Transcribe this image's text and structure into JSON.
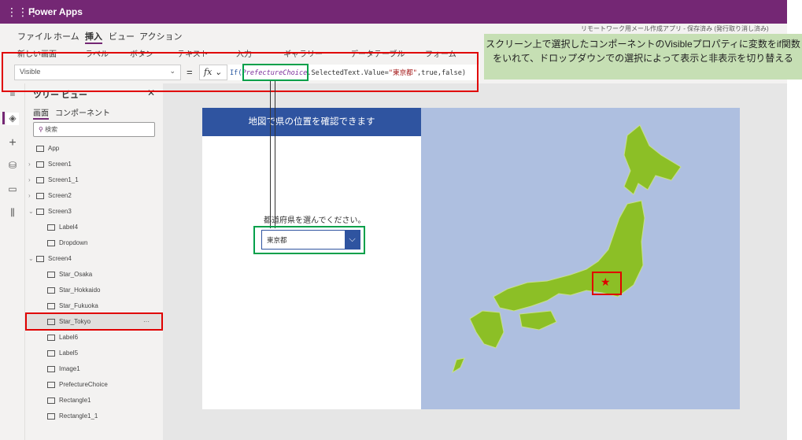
{
  "titlebar": {
    "app_name": "Power Apps",
    "waffle_icon": "waffle-icon"
  },
  "status": "リモートワーク用メール作成アプリ - 保存済み (発行取り消し済み)",
  "menu": [
    "ファイル",
    "ホーム",
    "挿入",
    "ビュー",
    "アクション"
  ],
  "menu_active": "挿入",
  "toolbar": [
    "新しい画面",
    "ラベル",
    "ボタン",
    "テキスト",
    "入力",
    "ギャラリー",
    "データテーブル",
    "フォーム"
  ],
  "formula_bar": {
    "property": "Visible",
    "equals": "=",
    "fx": "fx",
    "f_if": "If(",
    "f_ctl": "PrefectureChoice",
    "f_mid": ".SelectedText.Value=",
    "f_str": "\"東京都\"",
    "f_end": ",true,false)"
  },
  "tree": {
    "title": "ツリー ビュー",
    "tabs": [
      "画面",
      "コンポーネント"
    ],
    "search_placeholder": "検索",
    "items": [
      {
        "label": "App",
        "level": 0
      },
      {
        "label": "Screen1",
        "level": 0
      },
      {
        "label": "Screen1_1",
        "level": 0
      },
      {
        "label": "Screen2",
        "level": 0
      },
      {
        "label": "Screen3",
        "level": 0
      },
      {
        "label": "Label4",
        "level": 1
      },
      {
        "label": "Dropdown",
        "level": 1
      },
      {
        "label": "Screen4",
        "level": 0
      },
      {
        "label": "Star_Osaka",
        "level": 1
      },
      {
        "label": "Star_Hokkaido",
        "level": 1
      },
      {
        "label": "Star_Fukuoka",
        "level": 1
      },
      {
        "label": "Star_Tokyo",
        "level": 1,
        "selected": true
      },
      {
        "label": "Label6",
        "level": 1
      },
      {
        "label": "Label5",
        "level": 1
      },
      {
        "label": "Image1",
        "level": 1
      },
      {
        "label": "PrefectureChoice",
        "level": 1
      },
      {
        "label": "Rectangle1",
        "level": 1
      },
      {
        "label": "Rectangle1_1",
        "level": 1
      }
    ],
    "more": "···"
  },
  "app": {
    "header": "地図で県の位置を確認できます",
    "prompt": "都道府県を選んでください。",
    "dropdown_value": "東京都",
    "chevron": "⌄"
  },
  "callout": "スクリーン上で選択したコンポーネントのVisibleプロパティに変数をif関数をいれて、ドロップダウンでの選択によって表示と非表示を切り替える",
  "colors": {
    "brand": "#742774",
    "header": "#2f54a0",
    "map_land": "#8cbf26",
    "map_sea": "#aebfe0",
    "callout": "#c6dfb4",
    "highlight_red": "#e00000",
    "highlight_green": "#00a04a"
  }
}
